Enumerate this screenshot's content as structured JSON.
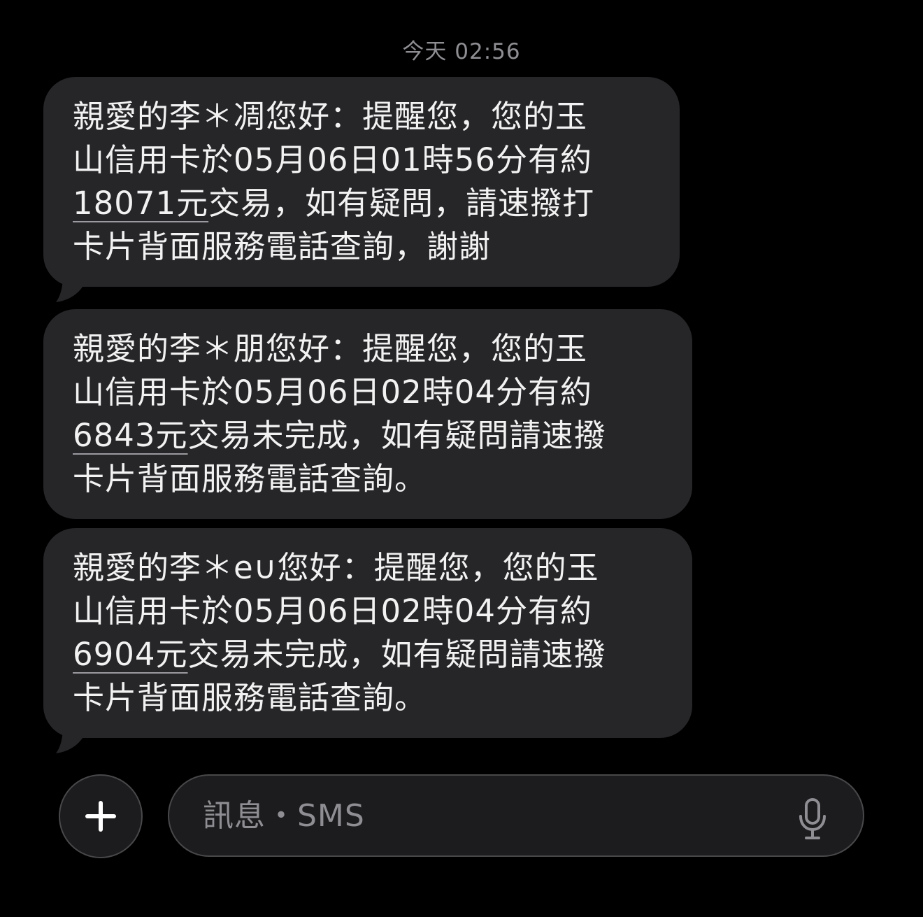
{
  "header": {
    "timestamp": "今天 02:56"
  },
  "messages": [
    {
      "lines": [
        "親愛的李＊凋您好：提醒您，您的玉",
        "山信用卡於05月06日01時56分有約"
      ],
      "amount": "18071元",
      "line3_rest": "交易，如有疑問，請速撥打",
      "line4": "卡片背面服務電話查詢，謝謝"
    },
    {
      "lines": [
        "親愛的李＊朋您好：提醒您，您的玉",
        "山信用卡於05月06日02時04分有約"
      ],
      "amount": "6843元",
      "line3_rest": "交易未完成，如有疑問請速撥",
      "line4": "卡片背面服務電話查詢。"
    },
    {
      "lines": [
        "親愛的李＊e∪您好：提醒您，您的玉",
        "山信用卡於05月06日02時04分有約"
      ],
      "amount": "6904元",
      "line3_rest": "交易未完成，如有疑問請速撥",
      "line4": "卡片背面服務電話查詢。"
    }
  ],
  "composer": {
    "placeholder": "訊息・SMS",
    "plus_icon": "plus-icon",
    "mic_icon": "microphone-icon"
  },
  "colors": {
    "background": "#000000",
    "bubble": "#262629",
    "timestamp": "#8e8e93",
    "placeholder": "#8e8e93"
  }
}
